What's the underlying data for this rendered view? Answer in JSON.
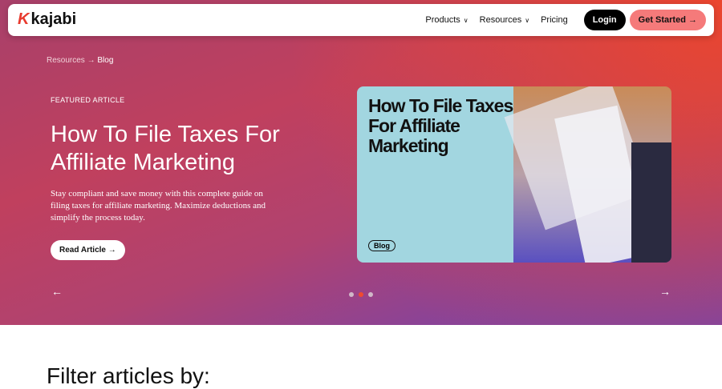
{
  "nav": {
    "logo": "kajabi",
    "products": "Products",
    "resources": "Resources",
    "pricing": "Pricing",
    "login": "Login",
    "get_started": "Get Started →"
  },
  "breadcrumb": {
    "parent": "Resources",
    "sep": "→",
    "current": "Blog"
  },
  "featured": {
    "label": "FEATURED ARTICLE",
    "title": "How To File Taxes For Affiliate Marketing",
    "description": "Stay compliant and save money with this complete guide on filing taxes for affiliate marketing. Maximize deductions and simplify the process today.",
    "cta": "Read Article →"
  },
  "card": {
    "title": "How To File Taxes For Affiliate Marketing",
    "tag": "Blog"
  },
  "carousel": {
    "prev": "←",
    "next": "→",
    "slides": 3,
    "active": 2
  },
  "filter": {
    "heading": "Filter articles by:"
  }
}
